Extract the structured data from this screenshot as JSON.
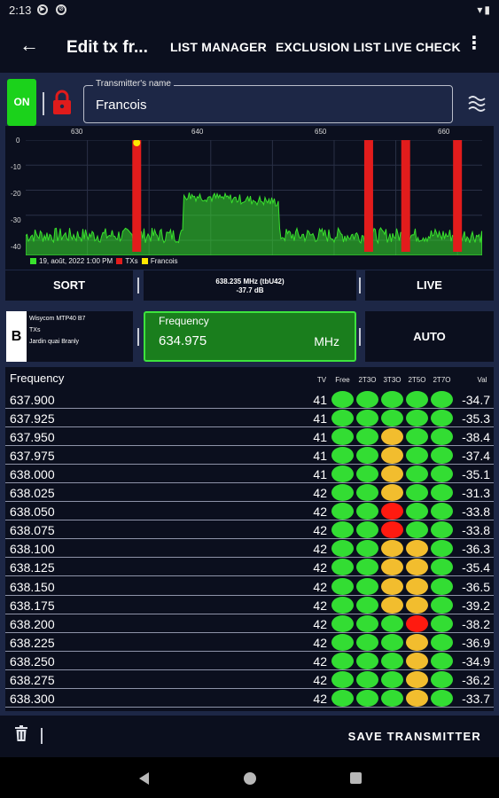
{
  "status_bar": {
    "time": "2:13",
    "icons": [
      "play-icon",
      "notification-icon",
      "wifi-icon",
      "battery-icon"
    ]
  },
  "app_bar": {
    "title": "Edit tx fr...",
    "actions": [
      "LIST MANAGER",
      "EXCLUSION LIST",
      "LIVE CHECK"
    ]
  },
  "transmitter": {
    "on_label": "ON",
    "name_label": "Transmitter's name",
    "name_value": "Francois"
  },
  "chart": {
    "legend_time": "19, août, 2022 1:00 PM",
    "legend_txs": "TXs",
    "legend_tx": "Francois",
    "colors": {
      "trace": "#39e12d",
      "txs": "#e21c1c",
      "marker": "#ffe600"
    }
  },
  "chart_data": {
    "type": "area",
    "x_ticks": [
      "630",
      "640",
      "650",
      "660"
    ],
    "y_ticks": [
      "0",
      "-10",
      "-20",
      "-30",
      "-40"
    ],
    "xlim": [
      625,
      662
    ],
    "ylim": [
      -46,
      0
    ],
    "noise_floor": -38,
    "occupied_band": {
      "from": 637.8,
      "to": 645.5,
      "level": -22
    },
    "tx_bars": [
      634.0,
      652.8,
      655.8,
      660.0
    ],
    "marker": 634.0
  },
  "controls": {
    "sort": "SORT",
    "live": "LIVE",
    "info_line1": "638.235 MHz  (tbU42)",
    "info_line2": "-37.7 dB",
    "channel": "B",
    "receiver": [
      "Wisycom MTP40 B7",
      "TXs",
      "Jardin quai Branly"
    ],
    "freq_label": "Frequency",
    "freq_value": "634.975",
    "freq_unit": "MHz",
    "auto": "AUTO"
  },
  "table": {
    "col_freq": "Frequency",
    "col_tv": "TV",
    "col_free": "Free",
    "col_2t3o": "2T3O",
    "col_3t3o": "3T3O",
    "col_2t5o": "2T5O",
    "col_2t7o": "2T7O",
    "col_val": "Val",
    "status_colors": {
      "g": "#33dd33",
      "y": "#f2bd2e",
      "r": "#ff1a10"
    },
    "rows": [
      {
        "freq": "637.900",
        "tv": "41",
        "status": [
          "g",
          "g",
          "g",
          "g",
          "g"
        ],
        "val": "-34.7"
      },
      {
        "freq": "637.925",
        "tv": "41",
        "status": [
          "g",
          "g",
          "g",
          "g",
          "g"
        ],
        "val": "-35.3"
      },
      {
        "freq": "637.950",
        "tv": "41",
        "status": [
          "g",
          "g",
          "y",
          "g",
          "g"
        ],
        "val": "-38.4"
      },
      {
        "freq": "637.975",
        "tv": "41",
        "status": [
          "g",
          "g",
          "y",
          "g",
          "g"
        ],
        "val": "-37.4"
      },
      {
        "freq": "638.000",
        "tv": "41",
        "status": [
          "g",
          "g",
          "y",
          "g",
          "g"
        ],
        "val": "-35.1"
      },
      {
        "freq": "638.025",
        "tv": "42",
        "status": [
          "g",
          "g",
          "y",
          "g",
          "g"
        ],
        "val": "-31.3"
      },
      {
        "freq": "638.050",
        "tv": "42",
        "status": [
          "g",
          "g",
          "r",
          "g",
          "g"
        ],
        "val": "-33.8"
      },
      {
        "freq": "638.075",
        "tv": "42",
        "status": [
          "g",
          "g",
          "r",
          "g",
          "g"
        ],
        "val": "-33.8"
      },
      {
        "freq": "638.100",
        "tv": "42",
        "status": [
          "g",
          "g",
          "y",
          "y",
          "g"
        ],
        "val": "-36.3"
      },
      {
        "freq": "638.125",
        "tv": "42",
        "status": [
          "g",
          "g",
          "y",
          "y",
          "g"
        ],
        "val": "-35.4"
      },
      {
        "freq": "638.150",
        "tv": "42",
        "status": [
          "g",
          "g",
          "y",
          "y",
          "g"
        ],
        "val": "-36.5"
      },
      {
        "freq": "638.175",
        "tv": "42",
        "status": [
          "g",
          "g",
          "y",
          "y",
          "g"
        ],
        "val": "-39.2"
      },
      {
        "freq": "638.200",
        "tv": "42",
        "status": [
          "g",
          "g",
          "g",
          "r",
          "g"
        ],
        "val": "-38.2"
      },
      {
        "freq": "638.225",
        "tv": "42",
        "status": [
          "g",
          "g",
          "g",
          "y",
          "g"
        ],
        "val": "-36.9"
      },
      {
        "freq": "638.250",
        "tv": "42",
        "status": [
          "g",
          "g",
          "g",
          "y",
          "g"
        ],
        "val": "-34.9"
      },
      {
        "freq": "638.275",
        "tv": "42",
        "status": [
          "g",
          "g",
          "g",
          "y",
          "g"
        ],
        "val": "-36.2"
      },
      {
        "freq": "638.300",
        "tv": "42",
        "status": [
          "g",
          "g",
          "g",
          "y",
          "g"
        ],
        "val": "-33.7"
      }
    ]
  },
  "bottom": {
    "save": "SAVE TRANSMITTER"
  }
}
